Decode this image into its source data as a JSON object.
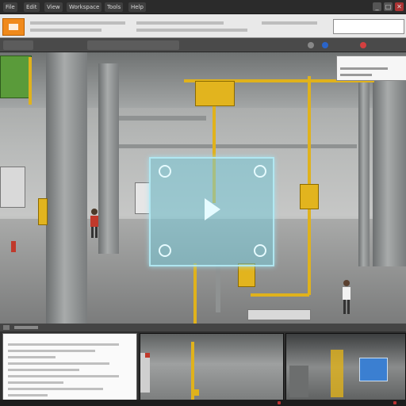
{
  "menubar": {
    "items": [
      "File",
      "Edit",
      "View",
      "Workspace",
      "Tools",
      "Help"
    ],
    "controls": [
      "_",
      "□",
      "✕"
    ]
  },
  "toolbar": {
    "labels": [
      "",
      "",
      ""
    ],
    "search_placeholder": ""
  },
  "tabs": [
    "",
    "",
    ""
  ],
  "status_icons": [
    "info-icon",
    "layer-icon",
    "alert-icon"
  ],
  "viewport": {
    "overlay_panel": {
      "label": ""
    },
    "hologram": {
      "icon_top_left": "settings-icon",
      "icon_top_right": "target-icon",
      "icon_bottom_left": "settings-icon",
      "icon_bottom_right": "check-icon",
      "center": "play-icon"
    }
  },
  "bottom": {
    "doc": {
      "title": "",
      "lines": 9
    },
    "thumbnails": [
      "corridor-camera",
      "factory-camera"
    ]
  },
  "colors": {
    "accent": "#f08a1c",
    "pipe": "#e0b21c",
    "hologram": "#78c8d7",
    "alert": "#d33f3f",
    "link": "#2a64c8"
  }
}
